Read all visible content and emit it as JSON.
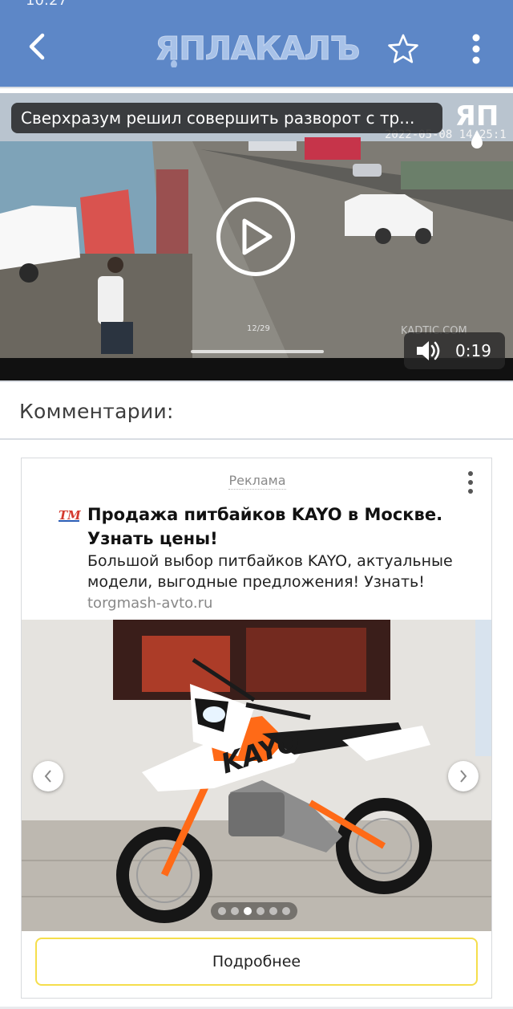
{
  "statusbar": {
    "time": "10:27"
  },
  "appbar": {
    "logo_text": "ЯПЛАКАЛЪ",
    "back_icon": "chevron-left-icon",
    "favorite_icon": "star-outline-icon",
    "menu_icon": "more-vertical-icon",
    "background_color": "#5d87c7"
  },
  "video": {
    "title": "Сверхразум решил совершить разворот с тр...",
    "watermark_logo": "ЯП",
    "timestamp": "2022-05-08 14:25:1",
    "counter": "12/29",
    "site_watermark": "KADTIC.COM",
    "duration": "0:19",
    "play_icon": "play-icon",
    "volume_icon": "volume-icon"
  },
  "comments": {
    "heading": "Комментарии:"
  },
  "ad": {
    "label": "Реклама",
    "favicon_text": "TM",
    "title": "Продажа питбайков KAYO в Москве. Узнать цены!",
    "description": "Большой выбор питбайков KAYO, актуальные модели, выгодные предложения! Узнать!",
    "domain": "torgmash-avto.ru",
    "image_brand": "KAYO",
    "carousel": {
      "total": 6,
      "active_index": 2
    },
    "cta_label": "Подробнее",
    "accent_color": "#f5de4c"
  }
}
